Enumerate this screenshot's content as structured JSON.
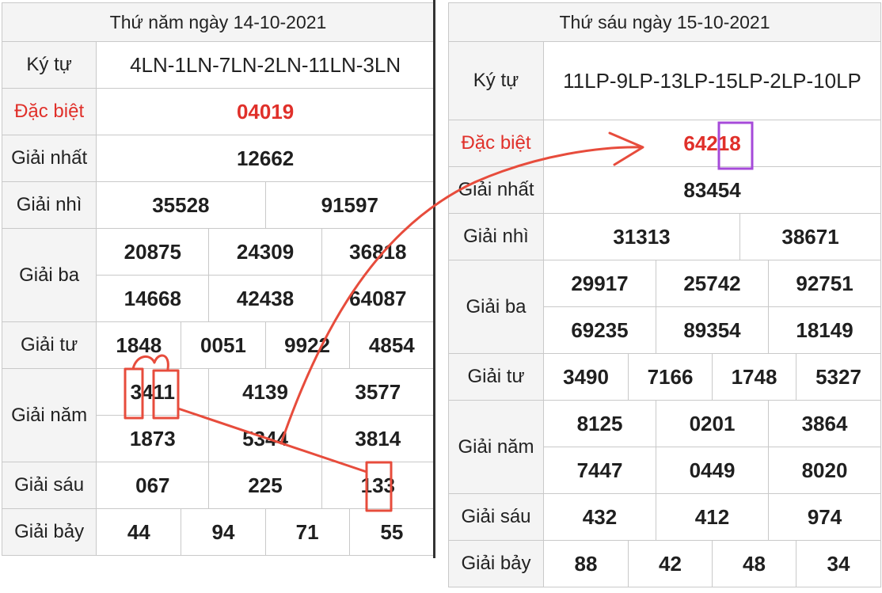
{
  "left": {
    "header": "Thứ năm ngày 14-10-2021",
    "labels": {
      "kytu": "Ký tự",
      "db": "Đặc biệt",
      "g1": "Giải nhất",
      "g2": "Giải nhì",
      "g3": "Giải ba",
      "g4": "Giải tư",
      "g5": "Giải năm",
      "g6": "Giải sáu",
      "g7": "Giải bảy"
    },
    "kytu": "4LN-1LN-7LN-2LN-11LN-3LN",
    "db": "04019",
    "g1": "12662",
    "g2": [
      "35528",
      "91597"
    ],
    "g3": [
      "20875",
      "24309",
      "36818",
      "14668",
      "42438",
      "64087"
    ],
    "g4": [
      "1848",
      "0051",
      "9922",
      "4854"
    ],
    "g5": [
      "3411",
      "4139",
      "3577",
      "1873",
      "5344",
      "3814"
    ],
    "g6": [
      "067",
      "225",
      "133"
    ],
    "g7": [
      "44",
      "94",
      "71",
      "55"
    ]
  },
  "right": {
    "header": "Thứ sáu ngày 15-10-2021",
    "labels": {
      "kytu": "Ký tự",
      "db": "Đặc biệt",
      "g1": "Giải nhất",
      "g2": "Giải nhì",
      "g3": "Giải ba",
      "g4": "Giải tư",
      "g5": "Giải năm",
      "g6": "Giải sáu",
      "g7": "Giải bảy"
    },
    "kytu": "11LP-9LP-13LP-15LP-2LP-10LP",
    "db": "64218",
    "g1": "83454",
    "g2": [
      "31313",
      "38671"
    ],
    "g3": [
      "29917",
      "25742",
      "92751",
      "69235",
      "89354",
      "18149"
    ],
    "g4": [
      "3490",
      "7166",
      "1748",
      "5327"
    ],
    "g5": [
      "8125",
      "0201",
      "3864",
      "7447",
      "0449",
      "8020"
    ],
    "g6": [
      "432",
      "412",
      "974"
    ],
    "g7": [
      "88",
      "42",
      "48",
      "34"
    ]
  },
  "colors": {
    "special": "#e0302a",
    "annotation_red": "#e74c3c",
    "annotation_purple": "#a64ad9"
  }
}
